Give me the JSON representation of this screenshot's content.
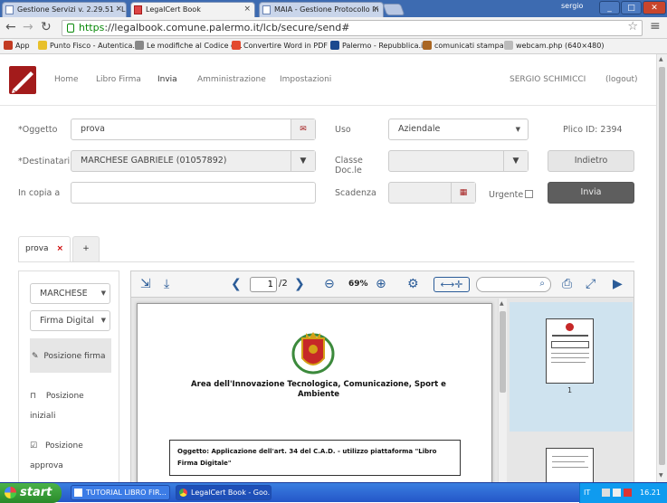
{
  "browser": {
    "tabs": [
      {
        "label": "Gestione Servizi v. 2.29.51 - L"
      },
      {
        "label": "LegalCert Book"
      },
      {
        "label": "MAIA - Gestione Protocollo In"
      }
    ],
    "user": "sergio",
    "window_buttons": {
      "minimize": "_",
      "maximize": "□",
      "close": "✕"
    },
    "url_scheme": "https",
    "url_rest": "://legalbook.comune.palermo.it/lcb/secure/send#",
    "bookmarks": [
      {
        "label": "App",
        "color": "#c23b22"
      },
      {
        "label": "Punto Fisco - Autentica...",
        "color": "#e8c02a"
      },
      {
        "label": "Le modifiche al Codice d...",
        "color": "#888888"
      },
      {
        "label": "Convertire Word in PDF",
        "color": "#e34a2e"
      },
      {
        "label": "Palermo - Repubblica.it",
        "color": "#1b4a8f"
      },
      {
        "label": "comunicati stampa",
        "color": "#aa6622"
      },
      {
        "label": "webcam.php (640×480)",
        "color": "#bbbbbb"
      }
    ]
  },
  "app": {
    "nav": [
      "Home",
      "Libro Firma",
      "Invia",
      "Amministrazione",
      "Impostazioni"
    ],
    "user_name": "SERGIO SCHIMICCI",
    "logout": "(logout)"
  },
  "form": {
    "oggetto_label": "*Oggetto",
    "oggetto_value": "prova",
    "destinatari_label": "*Destinatari",
    "destinatari_value": "MARCHESE GABRIELE (01057892)",
    "copia_label": "In copia a",
    "copia_value": "",
    "uso_label": "Uso",
    "uso_value": "Aziendale",
    "classe_label": "Classe Doc.le",
    "classe_value": "",
    "scadenza_label": "Scadenza",
    "scadenza_value": "",
    "urgente_label": "Urgente",
    "plico_label": "Plico ID: 2394",
    "indietro": "Indietro",
    "invia": "Invia"
  },
  "doc_tabs": [
    {
      "label": "prova",
      "close": "×"
    },
    {
      "label": "+"
    }
  ],
  "left_panel": {
    "signer": "MARCHESE",
    "sign_type": "Firma Digital",
    "items": [
      {
        "label": "Posizione firma",
        "active": true
      },
      {
        "label": "Posizione iniziali",
        "active": false
      },
      {
        "label": "Posizione approva",
        "active": false
      }
    ]
  },
  "viewer": {
    "page_current": "1",
    "page_total": "/2",
    "zoom": "69%",
    "search_value": "",
    "doc_heading": "Area dell'Innovazione Tecnologica, Comunicazione, Sport e Ambiente",
    "doc_oggetto": "Oggetto: Applicazione dell'art. 34 del C.A.D. - utilizzo piattaforma \"Libro Firma Digitale\"",
    "thumb_label": "1"
  },
  "taskbar": {
    "start": "start",
    "tasks": [
      "TUTORIAL LIBRO FIR...",
      "LegalCert Book - Goo..."
    ],
    "lang": "IT",
    "clock": "16.21"
  }
}
